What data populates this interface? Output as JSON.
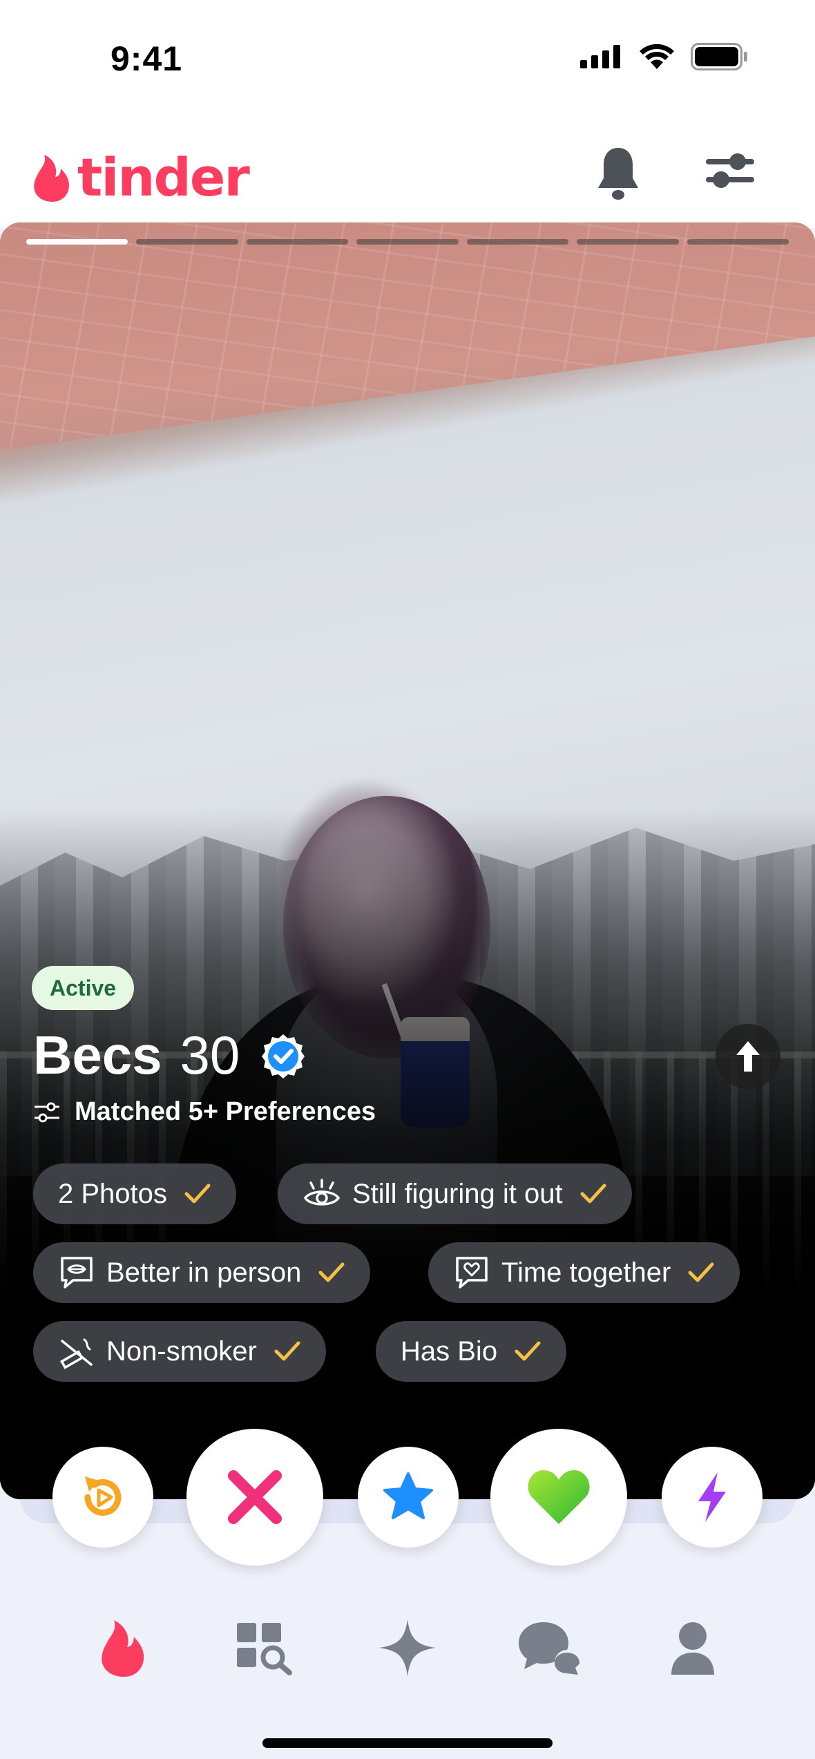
{
  "status_bar": {
    "time": "9:41"
  },
  "header": {
    "brand": "tinder",
    "notifications_icon": "bell-icon",
    "filters_icon": "sliders-icon"
  },
  "profile": {
    "photo_count_segments": 7,
    "active_segment": 0,
    "active_label": "Active",
    "name": "Becs",
    "age": "30",
    "preferences_label": "Matched 5+ Preferences",
    "chips": [
      {
        "label": "2 Photos",
        "icon": ""
      },
      {
        "label": "Still figuring it out",
        "icon": "eye-icon"
      },
      {
        "label": "Better in person",
        "icon": "chat-lips-icon"
      },
      {
        "label": "Time together",
        "icon": "chat-heart-icon"
      },
      {
        "label": "Non-smoker",
        "icon": "no-smoking-icon"
      },
      {
        "label": "Has Bio",
        "icon": ""
      }
    ]
  },
  "actions": {
    "rewind": "rewind-icon",
    "nope": "x-icon",
    "super_like": "star-icon",
    "like": "heart-icon",
    "boost": "bolt-icon"
  },
  "nav": {
    "items": [
      "flame-icon",
      "explore-icon",
      "sparkle-icon",
      "chat-icon",
      "profile-icon"
    ],
    "active_index": 0
  },
  "colors": {
    "brand": "#fd3d5f",
    "check": "#f5c043",
    "nope": "#f0307a",
    "star": "#1e8fff",
    "like": "#5ad130",
    "boost": "#a43ef5",
    "rewind": "#f5a623",
    "nav_inactive": "#7a7f8c"
  }
}
